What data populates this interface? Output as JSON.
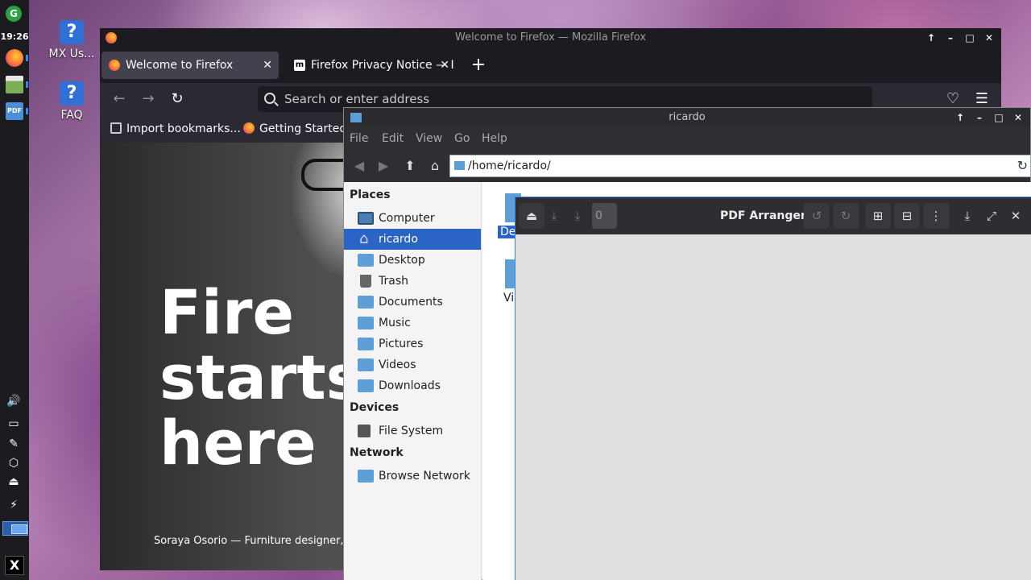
{
  "panel": {
    "clock": "19:26",
    "update_icon_label": "G",
    "pdf_label": "PDF",
    "mx_label": "X"
  },
  "desktop": {
    "icons": [
      {
        "label": "MX Us..."
      },
      {
        "label": "FAQ"
      }
    ]
  },
  "firefox": {
    "title": "Welcome to Firefox — Mozilla Firefox",
    "tabs": [
      {
        "label": "Welcome to Firefox"
      },
      {
        "label": "Firefox Privacy Notice — I"
      }
    ],
    "tab_favicon_letter": "m",
    "url_placeholder": "Search or enter address",
    "bookmarks": [
      {
        "label": "Import bookmarks..."
      },
      {
        "label": "Getting Started"
      }
    ],
    "hero_lines": [
      "Fire",
      "starts",
      "here"
    ],
    "hero_caption": "Soraya Osorio — Furniture designer, Fir"
  },
  "filemanager": {
    "title": "ricardo",
    "menu": [
      "File",
      "Edit",
      "View",
      "Go",
      "Help"
    ],
    "path": "/home/ricardo/",
    "groups": {
      "places": "Places",
      "devices": "Devices",
      "network": "Network"
    },
    "places": [
      {
        "label": "Computer",
        "icon": "computer-icon"
      },
      {
        "label": "ricardo",
        "icon": "home-icon"
      },
      {
        "label": "Desktop",
        "icon": "desktop-folder-icon"
      },
      {
        "label": "Trash",
        "icon": "trash-icon"
      },
      {
        "label": "Documents",
        "icon": "documents-folder-icon"
      },
      {
        "label": "Music",
        "icon": "music-folder-icon"
      },
      {
        "label": "Pictures",
        "icon": "pictures-folder-icon"
      },
      {
        "label": "Videos",
        "icon": "videos-folder-icon"
      },
      {
        "label": "Downloads",
        "icon": "downloads-folder-icon"
      }
    ],
    "devices": [
      {
        "label": "File System",
        "icon": "drive-icon"
      }
    ],
    "network": [
      {
        "label": "Browse Network",
        "icon": "network-folder-icon"
      }
    ],
    "files_visible": [
      {
        "label": "De"
      },
      {
        "label": "Vi"
      }
    ],
    "selected_color": "#2a64c5"
  },
  "pdfarranger": {
    "title": "PDF Arranger",
    "page_value": "0",
    "accent": "#3584e4"
  }
}
